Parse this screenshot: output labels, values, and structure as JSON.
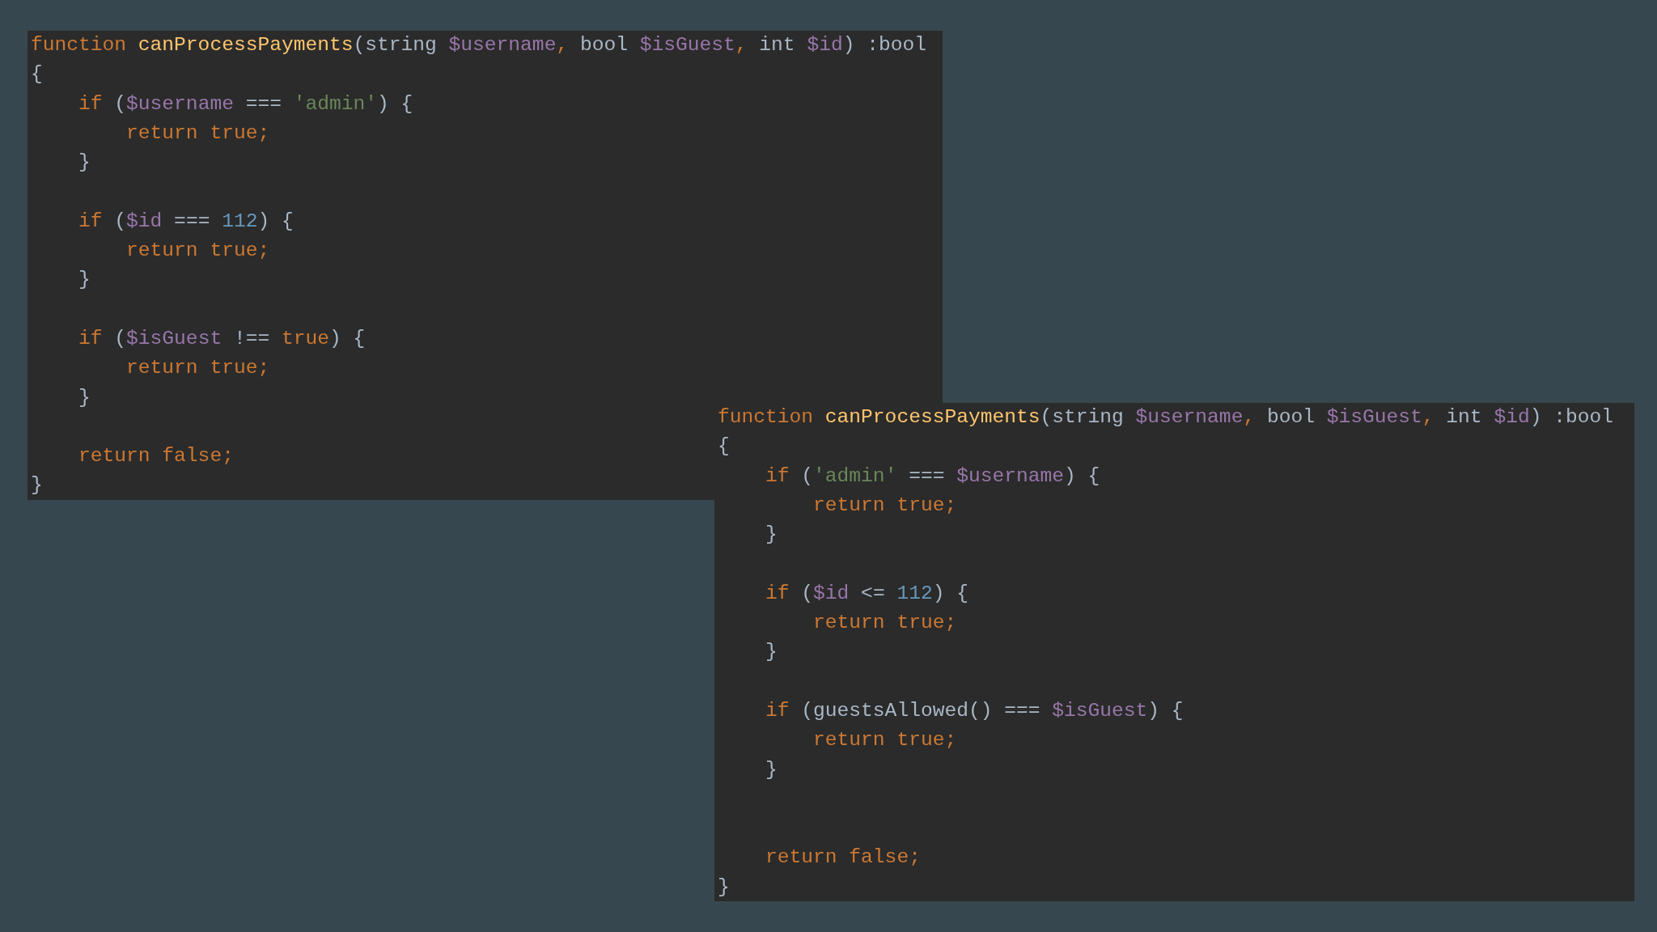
{
  "snippets": [
    {
      "lines": [
        {
          "kind": "code",
          "tokens": [
            {
              "kind": "kw",
              "text": "function "
            },
            {
              "kind": "fn",
              "text": "canProcessPayments"
            },
            {
              "kind": "plain",
              "text": "(string "
            },
            {
              "kind": "var",
              "text": "$username"
            },
            {
              "kind": "kw",
              "text": ", "
            },
            {
              "kind": "plain",
              "text": "bool "
            },
            {
              "kind": "var",
              "text": "$isGuest"
            },
            {
              "kind": "kw",
              "text": ", "
            },
            {
              "kind": "plain",
              "text": "int "
            },
            {
              "kind": "var",
              "text": "$id"
            },
            {
              "kind": "plain",
              "text": ") :bool"
            }
          ]
        },
        {
          "kind": "code",
          "tokens": [
            {
              "kind": "plain",
              "text": "{"
            }
          ]
        },
        {
          "kind": "code",
          "tokens": [
            {
              "kind": "kw",
              "text": "    if "
            },
            {
              "kind": "plain",
              "text": "("
            },
            {
              "kind": "var",
              "text": "$username"
            },
            {
              "kind": "plain",
              "text": " === "
            },
            {
              "kind": "str",
              "text": "'admin'"
            },
            {
              "kind": "plain",
              "text": ") {"
            }
          ]
        },
        {
          "kind": "code",
          "tokens": [
            {
              "kind": "kw",
              "text": "        return true;"
            }
          ]
        },
        {
          "kind": "code",
          "tokens": [
            {
              "kind": "plain",
              "text": "    }"
            }
          ]
        },
        {
          "kind": "blank"
        },
        {
          "kind": "code",
          "tokens": [
            {
              "kind": "kw",
              "text": "    if "
            },
            {
              "kind": "plain",
              "text": "("
            },
            {
              "kind": "var",
              "text": "$id"
            },
            {
              "kind": "plain",
              "text": " === "
            },
            {
              "kind": "num",
              "text": "112"
            },
            {
              "kind": "plain",
              "text": ") {"
            }
          ]
        },
        {
          "kind": "code",
          "tokens": [
            {
              "kind": "kw",
              "text": "        return true;"
            }
          ]
        },
        {
          "kind": "code",
          "tokens": [
            {
              "kind": "plain",
              "text": "    }"
            }
          ]
        },
        {
          "kind": "blank"
        },
        {
          "kind": "code",
          "tokens": [
            {
              "kind": "kw",
              "text": "    if "
            },
            {
              "kind": "plain",
              "text": "("
            },
            {
              "kind": "var",
              "text": "$isGuest"
            },
            {
              "kind": "plain",
              "text": " !== "
            },
            {
              "kind": "kw",
              "text": "true"
            },
            {
              "kind": "plain",
              "text": ") {"
            }
          ]
        },
        {
          "kind": "code",
          "tokens": [
            {
              "kind": "kw",
              "text": "        return true;"
            }
          ]
        },
        {
          "kind": "code",
          "tokens": [
            {
              "kind": "plain",
              "text": "    }"
            }
          ]
        },
        {
          "kind": "blank"
        },
        {
          "kind": "code",
          "tokens": [
            {
              "kind": "kw",
              "text": "    return false;"
            }
          ]
        },
        {
          "kind": "code",
          "tokens": [
            {
              "kind": "plain",
              "text": "}"
            }
          ]
        }
      ]
    },
    {
      "lines": [
        {
          "kind": "code",
          "tokens": [
            {
              "kind": "kw",
              "text": "function "
            },
            {
              "kind": "fn",
              "text": "canProcessPayments"
            },
            {
              "kind": "plain",
              "text": "(string "
            },
            {
              "kind": "var",
              "text": "$username"
            },
            {
              "kind": "kw",
              "text": ", "
            },
            {
              "kind": "plain",
              "text": "bool "
            },
            {
              "kind": "var",
              "text": "$isGuest"
            },
            {
              "kind": "kw",
              "text": ", "
            },
            {
              "kind": "plain",
              "text": "int "
            },
            {
              "kind": "var",
              "text": "$id"
            },
            {
              "kind": "plain",
              "text": ") :bool"
            }
          ]
        },
        {
          "kind": "code",
          "tokens": [
            {
              "kind": "plain",
              "text": "{"
            }
          ]
        },
        {
          "kind": "code",
          "tokens": [
            {
              "kind": "kw",
              "text": "    if "
            },
            {
              "kind": "plain",
              "text": "("
            },
            {
              "kind": "str",
              "text": "'admin'"
            },
            {
              "kind": "plain",
              "text": " === "
            },
            {
              "kind": "var",
              "text": "$username"
            },
            {
              "kind": "plain",
              "text": ") {"
            }
          ]
        },
        {
          "kind": "code",
          "tokens": [
            {
              "kind": "kw",
              "text": "        return true;"
            }
          ]
        },
        {
          "kind": "code",
          "tokens": [
            {
              "kind": "plain",
              "text": "    }"
            }
          ]
        },
        {
          "kind": "blank"
        },
        {
          "kind": "code",
          "tokens": [
            {
              "kind": "kw",
              "text": "    if "
            },
            {
              "kind": "plain",
              "text": "("
            },
            {
              "kind": "var",
              "text": "$id"
            },
            {
              "kind": "plain",
              "text": " <= "
            },
            {
              "kind": "num",
              "text": "112"
            },
            {
              "kind": "plain",
              "text": ") {"
            }
          ]
        },
        {
          "kind": "code",
          "tokens": [
            {
              "kind": "kw",
              "text": "        return true;"
            }
          ]
        },
        {
          "kind": "code",
          "tokens": [
            {
              "kind": "plain",
              "text": "    }"
            }
          ]
        },
        {
          "kind": "blank"
        },
        {
          "kind": "code",
          "tokens": [
            {
              "kind": "kw",
              "text": "    if "
            },
            {
              "kind": "plain",
              "text": "(guestsAllowed() === "
            },
            {
              "kind": "var",
              "text": "$isGuest"
            },
            {
              "kind": "plain",
              "text": ") {"
            }
          ]
        },
        {
          "kind": "code",
          "tokens": [
            {
              "kind": "kw",
              "text": "        return true;"
            }
          ]
        },
        {
          "kind": "code",
          "tokens": [
            {
              "kind": "plain",
              "text": "    }"
            }
          ]
        },
        {
          "kind": "blank"
        },
        {
          "kind": "blank"
        },
        {
          "kind": "code",
          "tokens": [
            {
              "kind": "kw",
              "text": "    return false;"
            }
          ]
        },
        {
          "kind": "code",
          "tokens": [
            {
              "kind": "plain",
              "text": "}"
            }
          ]
        }
      ]
    }
  ]
}
